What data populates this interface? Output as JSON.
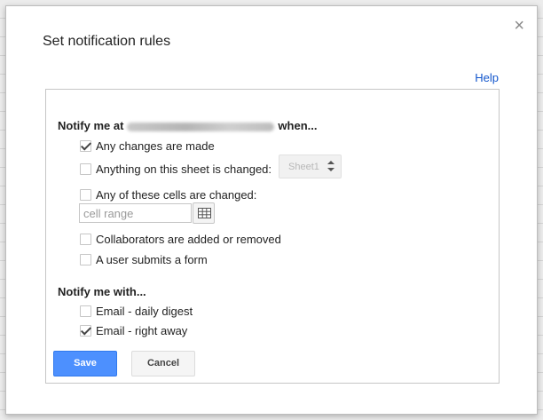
{
  "dialog": {
    "title": "Set notification rules",
    "close_glyph": "×",
    "help_label": "Help"
  },
  "notify_at": {
    "prefix": "Notify me at",
    "suffix": "when...",
    "options": [
      {
        "label": "Any changes are made",
        "checked": true
      },
      {
        "label": "Anything on this sheet is changed:",
        "checked": false
      },
      {
        "label": "Any of these cells are changed:",
        "checked": false
      },
      {
        "label": "Collaborators are added or removed",
        "checked": false
      },
      {
        "label": "A user submits a form",
        "checked": false
      }
    ],
    "sheet_select_value": "Sheet1",
    "cell_range_placeholder": "cell range"
  },
  "notify_with": {
    "title": "Notify me with...",
    "options": [
      {
        "label": "Email - daily digest",
        "checked": false
      },
      {
        "label": "Email - right away",
        "checked": true
      }
    ]
  },
  "buttons": {
    "save_label": "Save",
    "cancel_label": "Cancel"
  },
  "colors": {
    "primary": "#4d90fe",
    "link": "#1155cc"
  }
}
